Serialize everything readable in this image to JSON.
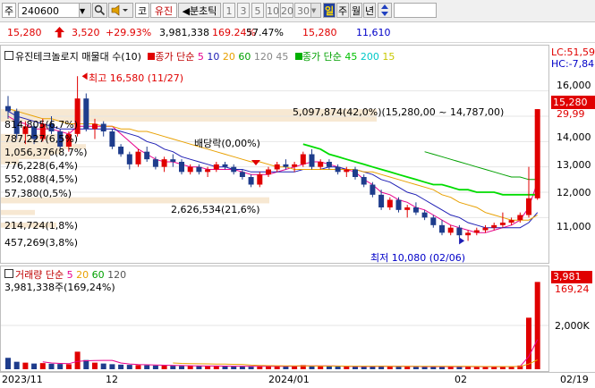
{
  "toolbar": {
    "market": "주",
    "code": "240600",
    "search_icon": "magnifier-icon",
    "speaker_icon": "speaker-icon",
    "co_prefix": "코",
    "company": "유진",
    "tick_label": "◀분초틱",
    "periods": [
      "1",
      "3",
      "5",
      "10",
      "20",
      "30"
    ],
    "daily": "일",
    "weekly": "주",
    "monthly": "월",
    "yearly": "년",
    "updown_icon": "updown-arrow-icon"
  },
  "quote": {
    "price": "15,280",
    "change": "3,520",
    "change_pct": "+29.93%",
    "volume": "3,981,338",
    "volume_pct": "169.24%",
    "rate": "57.47%",
    "ask": "15,280",
    "bid": "11,610"
  },
  "legend_price": {
    "indicator": "유진테크놀로지 매물대 수(10)",
    "ma_label": "종가 단순",
    "ma_values": [
      "5",
      "10",
      "20",
      "60",
      "120",
      "45"
    ],
    "ma2_label": "종가 단순",
    "ma2_values": [
      "45",
      "200",
      "15"
    ]
  },
  "legend_vol": {
    "label": "거래량 단순",
    "values": [
      "5",
      "20",
      "60",
      "120"
    ],
    "current": "3,981,338주(169,24%)"
  },
  "annotations": {
    "high": "최고 16,580 (11/27)",
    "low": "최저 10,080 (02/06)",
    "dividend": "배당락(0,00%)",
    "vp_top": "5,097,874(42,0%)(15,280,00 ~ 14,787,00)",
    "vp_mid": "2,626,534(21,6%)"
  },
  "volume_profile": [
    "814,805(6,7%)",
    "787,227(6,5%)",
    "1,056,376(8,7%)",
    "776,228(6,4%)",
    "552,088(4,5%)",
    "57,380(0,5%)",
    "214,724(1,8%)",
    "457,269(3,8%)"
  ],
  "right_axis": {
    "lc": "LC:51,59",
    "hc": "HC:-7,84",
    "ticks": [
      "16,000",
      "15,000",
      "14,000",
      "13,000",
      "12,000",
      "11,000"
    ],
    "current_price": "15,280",
    "ma_value": "29,99",
    "vol_current": "3,981",
    "vol_pct": "169,24",
    "vol_tick": "2,000K"
  },
  "xaxis": {
    "labels": [
      "2023/11",
      "12",
      "2024/01",
      "02",
      "02/19"
    ]
  },
  "colors": {
    "up": "#e00000",
    "down": "#1e3c8c",
    "ma5": "#e8008c",
    "ma10": "#1e1eb4",
    "ma20": "#e8a000",
    "ma60": "#00a000",
    "ma120": "#888888",
    "ma45": "#00dc00"
  },
  "chart_data": {
    "type": "candlestick",
    "ylim": [
      9600,
      16800
    ],
    "candles": [
      {
        "o": 15400,
        "h": 15800,
        "l": 14900,
        "c": 15200
      },
      {
        "o": 15200,
        "h": 15300,
        "l": 14100,
        "c": 14300
      },
      {
        "o": 14300,
        "h": 14800,
        "l": 13900,
        "c": 14600
      },
      {
        "o": 14600,
        "h": 14700,
        "l": 13900,
        "c": 14100
      },
      {
        "o": 14100,
        "h": 14900,
        "l": 14000,
        "c": 14700
      },
      {
        "o": 14700,
        "h": 15000,
        "l": 14300,
        "c": 14400
      },
      {
        "o": 14400,
        "h": 14500,
        "l": 13700,
        "c": 13800
      },
      {
        "o": 13800,
        "h": 14400,
        "l": 13600,
        "c": 14300
      },
      {
        "o": 14300,
        "h": 16580,
        "l": 14200,
        "c": 15700
      },
      {
        "o": 15700,
        "h": 15900,
        "l": 14400,
        "c": 14500
      },
      {
        "o": 14500,
        "h": 14900,
        "l": 14100,
        "c": 14700
      },
      {
        "o": 14700,
        "h": 14800,
        "l": 14200,
        "c": 14400
      },
      {
        "o": 14400,
        "h": 14500,
        "l": 13700,
        "c": 13800
      },
      {
        "o": 13800,
        "h": 13900,
        "l": 13400,
        "c": 13500
      },
      {
        "o": 13500,
        "h": 13600,
        "l": 12900,
        "c": 13100
      },
      {
        "o": 13100,
        "h": 13700,
        "l": 13000,
        "c": 13600
      },
      {
        "o": 13600,
        "h": 13800,
        "l": 13200,
        "c": 13300
      },
      {
        "o": 13300,
        "h": 13400,
        "l": 12900,
        "c": 13000
      },
      {
        "o": 13000,
        "h": 13400,
        "l": 12800,
        "c": 13300
      },
      {
        "o": 13300,
        "h": 13500,
        "l": 13000,
        "c": 13200
      },
      {
        "o": 13200,
        "h": 13300,
        "l": 12700,
        "c": 12800
      },
      {
        "o": 12800,
        "h": 13100,
        "l": 12700,
        "c": 13000
      },
      {
        "o": 13000,
        "h": 13100,
        "l": 12700,
        "c": 12800
      },
      {
        "o": 12800,
        "h": 13000,
        "l": 12600,
        "c": 12900
      },
      {
        "o": 12900,
        "h": 13200,
        "l": 12800,
        "c": 13100
      },
      {
        "o": 13100,
        "h": 13200,
        "l": 12900,
        "c": 13000
      },
      {
        "o": 13000,
        "h": 13100,
        "l": 12700,
        "c": 12800
      },
      {
        "o": 12800,
        "h": 12900,
        "l": 12500,
        "c": 12600
      },
      {
        "o": 12600,
        "h": 12700,
        "l": 12200,
        "c": 12300
      },
      {
        "o": 12300,
        "h": 12800,
        "l": 12200,
        "c": 12700
      },
      {
        "o": 12700,
        "h": 13000,
        "l": 12600,
        "c": 12900
      },
      {
        "o": 12900,
        "h": 13200,
        "l": 12800,
        "c": 13100
      },
      {
        "o": 13100,
        "h": 13300,
        "l": 12900,
        "c": 13000
      },
      {
        "o": 13000,
        "h": 13200,
        "l": 12800,
        "c": 13100
      },
      {
        "o": 13100,
        "h": 13600,
        "l": 13000,
        "c": 13500
      },
      {
        "o": 13500,
        "h": 13700,
        "l": 12900,
        "c": 13000
      },
      {
        "o": 13000,
        "h": 13300,
        "l": 12900,
        "c": 13200
      },
      {
        "o": 13200,
        "h": 13300,
        "l": 12900,
        "c": 13000
      },
      {
        "o": 13000,
        "h": 13100,
        "l": 12700,
        "c": 12800
      },
      {
        "o": 12800,
        "h": 13000,
        "l": 12600,
        "c": 12900
      },
      {
        "o": 12900,
        "h": 13000,
        "l": 12500,
        "c": 12600
      },
      {
        "o": 12600,
        "h": 12700,
        "l": 12200,
        "c": 12300
      },
      {
        "o": 12300,
        "h": 12400,
        "l": 11800,
        "c": 11900
      },
      {
        "o": 11900,
        "h": 12100,
        "l": 11300,
        "c": 11400
      },
      {
        "o": 11400,
        "h": 11800,
        "l": 11300,
        "c": 11700
      },
      {
        "o": 11700,
        "h": 11800,
        "l": 11200,
        "c": 11300
      },
      {
        "o": 11300,
        "h": 11500,
        "l": 11000,
        "c": 11400
      },
      {
        "o": 11400,
        "h": 11600,
        "l": 11100,
        "c": 11200
      },
      {
        "o": 11200,
        "h": 11300,
        "l": 10900,
        "c": 11000
      },
      {
        "o": 11000,
        "h": 11100,
        "l": 10600,
        "c": 10700
      },
      {
        "o": 10700,
        "h": 10900,
        "l": 10300,
        "c": 10400
      },
      {
        "o": 10400,
        "h": 10700,
        "l": 10300,
        "c": 10600
      },
      {
        "o": 10600,
        "h": 10700,
        "l": 10200,
        "c": 10300
      },
      {
        "o": 10300,
        "h": 10500,
        "l": 10080,
        "c": 10400
      },
      {
        "o": 10400,
        "h": 10600,
        "l": 10300,
        "c": 10500
      },
      {
        "o": 10500,
        "h": 10700,
        "l": 10400,
        "c": 10600
      },
      {
        "o": 10600,
        "h": 10800,
        "l": 10500,
        "c": 10700
      },
      {
        "o": 10700,
        "h": 11200,
        "l": 10600,
        "c": 10800
      },
      {
        "o": 10800,
        "h": 11000,
        "l": 10700,
        "c": 10900
      },
      {
        "o": 10900,
        "h": 11200,
        "l": 10800,
        "c": 11100
      },
      {
        "o": 11100,
        "h": 13000,
        "l": 11000,
        "c": 11760
      },
      {
        "o": 11760,
        "h": 15280,
        "l": 11700,
        "c": 15280
      }
    ],
    "volumes": [
      520,
      340,
      300,
      260,
      280,
      250,
      240,
      230,
      800,
      420,
      300,
      260,
      230,
      210,
      200,
      190,
      180,
      170,
      170,
      160,
      150,
      150,
      140,
      140,
      150,
      140,
      130,
      130,
      120,
      130,
      140,
      150,
      130,
      140,
      190,
      160,
      140,
      130,
      120,
      130,
      120,
      120,
      140,
      150,
      120,
      130,
      120,
      110,
      110,
      120,
      140,
      120,
      110,
      130,
      100,
      110,
      110,
      140,
      130,
      170,
      2350,
      3981
    ],
    "series": [
      {
        "name": "5",
        "values": [
          15000,
          14800,
          14700,
          14500,
          14500,
          14500,
          14400,
          14300,
          14600,
          14600,
          14600,
          14600,
          14600,
          14300,
          14000,
          13700,
          13500,
          13300,
          13200,
          13200,
          13100,
          13000,
          13000,
          12900,
          12900,
          12900,
          12900,
          12800,
          12700,
          12700,
          12700,
          12800,
          12900,
          13000,
          13100,
          13200,
          13200,
          13100,
          13000,
          12900,
          12800,
          12500,
          12300,
          12000,
          11900,
          11700,
          11600,
          11400,
          11300,
          11100,
          10900,
          10700,
          10600,
          10500,
          10400,
          10400,
          10500,
          10600,
          10700,
          10900,
          11400,
          12400
        ]
      },
      {
        "name": "10",
        "values": [
          15200,
          15000,
          14900,
          14800,
          14700,
          14600,
          14500,
          14500,
          14500,
          14500,
          14500,
          14500,
          14500,
          14400,
          14300,
          14200,
          14000,
          13900,
          13700,
          13600,
          13400,
          13300,
          13200,
          13100,
          13000,
          13000,
          12900,
          12900,
          12800,
          12800,
          12800,
          12800,
          12800,
          12800,
          12900,
          12900,
          12900,
          13000,
          13000,
          12900,
          12900,
          12800,
          12700,
          12500,
          12400,
          12200,
          12000,
          11900,
          11700,
          11500,
          11300,
          11100,
          11000,
          10800,
          10700,
          10600,
          10600,
          10600,
          10600,
          10600,
          10800,
          11200
        ]
      },
      {
        "name": "20",
        "values": [
          15300,
          15200,
          15100,
          15000,
          14900,
          14900,
          14800,
          14700,
          14700,
          14700,
          14700,
          14600,
          14600,
          14500,
          14500,
          14400,
          14400,
          14300,
          14200,
          14100,
          14000,
          13900,
          13800,
          13700,
          13600,
          13500,
          13400,
          13300,
          13200,
          13200,
          13100,
          13000,
          13000,
          12900,
          12900,
          12900,
          12900,
          12900,
          12900,
          12900,
          12900,
          12800,
          12800,
          12700,
          12600,
          12500,
          12400,
          12300,
          12200,
          12100,
          11900,
          11800,
          11600,
          11500,
          11400,
          11200,
          11100,
          11000,
          10900,
          10900,
          10900,
          11100
        ]
      },
      {
        "name": "45",
        "values": [
          null,
          null,
          null,
          null,
          null,
          null,
          null,
          null,
          null,
          null,
          null,
          null,
          null,
          null,
          null,
          null,
          null,
          null,
          null,
          null,
          null,
          null,
          null,
          null,
          null,
          null,
          null,
          null,
          null,
          null,
          null,
          null,
          null,
          null,
          13900,
          13800,
          13700,
          13500,
          13400,
          13300,
          13200,
          13100,
          13000,
          12900,
          12800,
          12700,
          12600,
          12500,
          12400,
          12300,
          12300,
          12200,
          12100,
          12100,
          12000,
          12000,
          12000,
          11900,
          11900,
          11900,
          11900,
          11900
        ]
      },
      {
        "name": "60",
        "values": [
          null,
          null,
          null,
          null,
          null,
          null,
          null,
          null,
          null,
          null,
          null,
          null,
          null,
          null,
          null,
          null,
          null,
          null,
          null,
          null,
          null,
          null,
          null,
          null,
          null,
          null,
          null,
          null,
          null,
          null,
          null,
          null,
          null,
          null,
          null,
          null,
          null,
          null,
          null,
          null,
          null,
          null,
          null,
          null,
          null,
          null,
          null,
          null,
          13600,
          13500,
          13400,
          13300,
          13200,
          13100,
          13000,
          12900,
          12800,
          12700,
          12600,
          12600,
          12500,
          12500
        ]
      }
    ]
  }
}
